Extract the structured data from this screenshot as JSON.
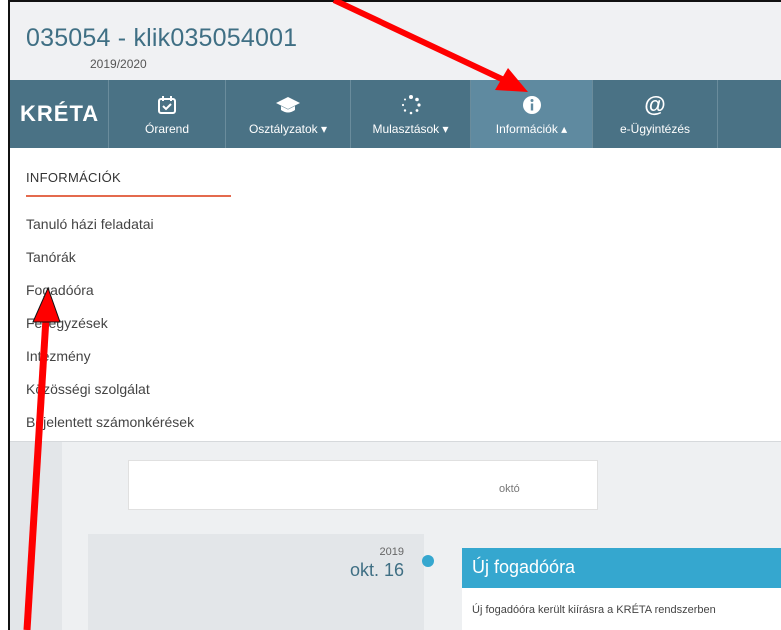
{
  "header": {
    "title": "035054 - klik035054001",
    "school_year": "2019/2020"
  },
  "brand": {
    "logo_text": "KRÉTA"
  },
  "nav": {
    "items": [
      {
        "label": "Órarend",
        "icon": "calendar-check-icon",
        "glyph": "📅"
      },
      {
        "label": "Osztályzatok ▾",
        "icon": "graduation-cap-icon",
        "glyph": "🎓"
      },
      {
        "label": "Mulasztások ▾",
        "icon": "spinner-dots-icon",
        "glyph": "⁘"
      },
      {
        "label": "Információk ▴",
        "icon": "info-circle-icon",
        "glyph": "ℹ"
      },
      {
        "label": "e-Ügyintézés",
        "icon": "at-icon",
        "glyph": "@"
      }
    ],
    "active_index": 3
  },
  "dropdown": {
    "heading": "INFORMÁCIÓK",
    "items": [
      "Tanuló házi feladatai",
      "Tanórák",
      "Fogadóóra",
      "Feljegyzések",
      "Intézmény",
      "Közösségi szolgálat",
      "Bejelentett számonkérések"
    ]
  },
  "timeline": {
    "top_card_text": "októ",
    "year": "2019",
    "date": "okt. 16",
    "event_title": "Új fogadóóra",
    "event_text": "Új fogadóóra került kiírásra a KRÉTA rendszerben"
  },
  "colors": {
    "header_title": "#3f6f84",
    "navbar": "#4a7285",
    "nav_active": "#5f8aa0",
    "accent_line": "#e46a4e",
    "event_blue": "#35a7cf",
    "annotation_arrow": "#ff0000"
  }
}
